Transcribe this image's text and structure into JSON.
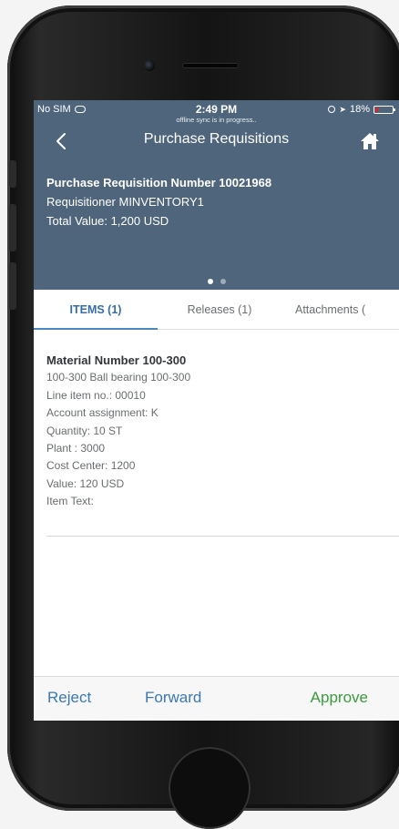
{
  "status_bar": {
    "carrier": "No SIM",
    "time": "2:49 PM",
    "sync_message": "offline sync is in progress..",
    "battery": "18%",
    "battery_level": 0.18,
    "battery_color": "#e0242a"
  },
  "nav": {
    "title": "Purchase Requisitions",
    "back_icon": "chevron-left-icon",
    "home_icon": "home-icon"
  },
  "header": {
    "number_label": "Purchase Requisition Number 10021968",
    "requisitioner": "Requisitioner MINVENTORY1",
    "total_value": "Total Value: 1,200 USD",
    "page_count": 2,
    "active_page": 1
  },
  "tabs": [
    {
      "label": "ITEMS (1)",
      "active": true
    },
    {
      "label": "Releases (1)",
      "active": false
    },
    {
      "label": "Attachments (",
      "active": false
    }
  ],
  "item": {
    "title": "Material Number 100-300",
    "lines": [
      "100-300 Ball bearing 100-300",
      "Line item no.: 00010",
      "Account assignment: K",
      "Quantity: 10 ST",
      "Plant : 3000",
      "Cost Center: 1200",
      "Value: 120 USD",
      "Item Text:"
    ]
  },
  "footer": {
    "reject": "Reject",
    "forward": "Forward",
    "approve": "Approve"
  },
  "colors": {
    "header_bg": "#4f657b",
    "accent_blue": "#3a78b8",
    "approve_green": "#3a9c3f"
  }
}
